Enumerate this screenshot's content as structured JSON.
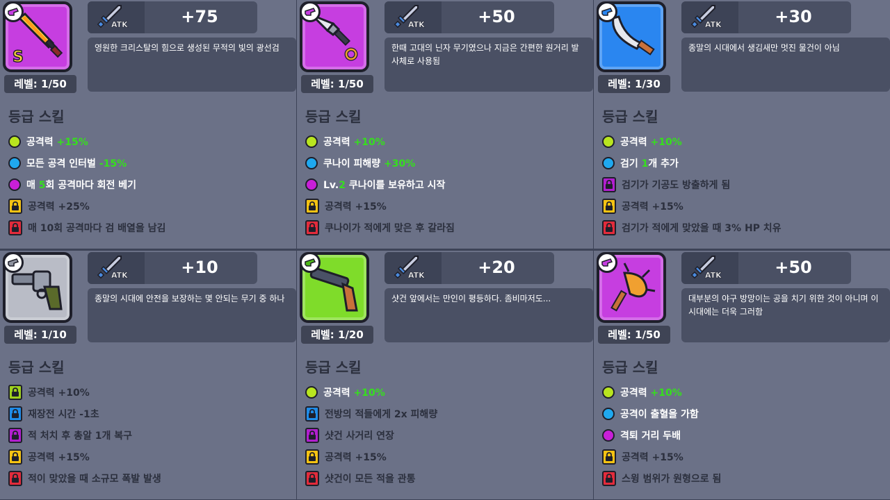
{
  "stat_icon_label": "ATK",
  "skill_header": "등급 스킬",
  "cards": [
    {
      "rarity": "purple",
      "hand_color": "#c63ee0",
      "item_icon": "light-sword-icon",
      "grade_mark": "S",
      "atk": "+75",
      "description": "영원한 크리스탈의 힘으로 생성된 무적의 빛의 광선검",
      "level": "레벨: 1/50",
      "skills": [
        {
          "kind": "dot",
          "color": "lime",
          "pre": "공격력 ",
          "hl": "+15%",
          "post": "",
          "locked": false
        },
        {
          "kind": "dot",
          "color": "cyan",
          "pre": "모든 공격 인터벌 ",
          "hl": "-15%",
          "post": "",
          "locked": false
        },
        {
          "kind": "dot",
          "color": "magenta",
          "pre": "매 ",
          "hl": "5",
          "post": "회 공격마다 회전 베기",
          "locked": false
        },
        {
          "kind": "lock",
          "color": "yellow",
          "pre": "공격력 +25%",
          "hl": "",
          "post": "",
          "locked": true
        },
        {
          "kind": "lock",
          "color": "red",
          "pre": "매 10회 공격마다 검 배열을 남김",
          "hl": "",
          "post": "",
          "locked": true
        }
      ]
    },
    {
      "rarity": "purple",
      "hand_color": "#c63ee0",
      "item_icon": "kunai-icon",
      "grade_mark": "",
      "atk": "+50",
      "description": "한때 고대의 닌자 무기였으나 지금은 간편한 원거리 발사체로 사용됨",
      "level": "레벨: 1/50",
      "skills": [
        {
          "kind": "dot",
          "color": "lime",
          "pre": "공격력 ",
          "hl": "+10%",
          "post": "",
          "locked": false
        },
        {
          "kind": "dot",
          "color": "cyan",
          "pre": "쿠나이 피해량 ",
          "hl": "+30%",
          "post": "",
          "locked": false
        },
        {
          "kind": "dot",
          "color": "magenta",
          "pre": "Lv.",
          "hl": "2",
          "post": " 쿠나이를 보유하고 시작",
          "locked": false
        },
        {
          "kind": "lock",
          "color": "yellow",
          "pre": "공격력 +15%",
          "hl": "",
          "post": "",
          "locked": true
        },
        {
          "kind": "lock",
          "color": "red",
          "pre": "쿠나이가 적에게 맞은 후 갈라짐",
          "hl": "",
          "post": "",
          "locked": true
        }
      ]
    },
    {
      "rarity": "blue",
      "hand_color": "#2a86f0",
      "item_icon": "machete-icon",
      "grade_mark": "",
      "atk": "+30",
      "description": "종말의 시대에서 생김새만 멋진 물건이 아님",
      "level": "레벨: 1/30",
      "skills": [
        {
          "kind": "dot",
          "color": "lime",
          "pre": "공격력 ",
          "hl": "+10%",
          "post": "",
          "locked": false
        },
        {
          "kind": "dot",
          "color": "cyan",
          "pre": "검기 ",
          "hl": "1",
          "post": "개 추가",
          "locked": false
        },
        {
          "kind": "lock",
          "color": "magenta",
          "pre": "검기가 기공도 방출하게 됨",
          "hl": "",
          "post": "",
          "locked": true
        },
        {
          "kind": "lock",
          "color": "yellow",
          "pre": "공격력 +15%",
          "hl": "",
          "post": "",
          "locked": true
        },
        {
          "kind": "lock",
          "color": "red",
          "pre": "검기가 적에게 맞았을 때 3% HP 치유",
          "hl": "",
          "post": "",
          "locked": true
        }
      ]
    },
    {
      "rarity": "gray",
      "hand_color": "#8f939f",
      "item_icon": "revolver-icon",
      "grade_mark": "",
      "atk": "+10",
      "description": "종말의 시대에 안전을 보장하는 몇 안되는 무기 중 하나",
      "level": "레벨: 1/10",
      "skills": [
        {
          "kind": "lock",
          "color": "lime",
          "pre": "공격력 +10%",
          "hl": "",
          "post": "",
          "locked": true
        },
        {
          "kind": "lock",
          "color": "cyan",
          "pre": "재장전 시간 -1초",
          "hl": "",
          "post": "",
          "locked": true
        },
        {
          "kind": "lock",
          "color": "magenta",
          "pre": "적 처치 후 총알 1개 복구",
          "hl": "",
          "post": "",
          "locked": true
        },
        {
          "kind": "lock",
          "color": "yellow",
          "pre": "공격력 +15%",
          "hl": "",
          "post": "",
          "locked": true
        },
        {
          "kind": "lock",
          "color": "red",
          "pre": "적이 맞았을 때 소규모 폭발 발생",
          "hl": "",
          "post": "",
          "locked": true
        }
      ]
    },
    {
      "rarity": "green",
      "hand_color": "#4fb81a",
      "item_icon": "shotgun-icon",
      "grade_mark": "",
      "atk": "+20",
      "description": "샷건 앞에서는 만인이 평등하다. 좀비마저도...",
      "level": "레벨: 1/20",
      "skills": [
        {
          "kind": "dot",
          "color": "lime",
          "pre": "공격력 ",
          "hl": "+10%",
          "post": "",
          "locked": false
        },
        {
          "kind": "lock",
          "color": "cyan",
          "pre": "전방의 적들에게 2x 피해량",
          "hl": "",
          "post": "",
          "locked": true
        },
        {
          "kind": "lock",
          "color": "magenta",
          "pre": "샷건 사거리 연장",
          "hl": "",
          "post": "",
          "locked": true
        },
        {
          "kind": "lock",
          "color": "yellow",
          "pre": "공격력 +15%",
          "hl": "",
          "post": "",
          "locked": true
        },
        {
          "kind": "lock",
          "color": "red",
          "pre": "샷건이 모든 적을 관통",
          "hl": "",
          "post": "",
          "locked": true
        }
      ]
    },
    {
      "rarity": "purple",
      "hand_color": "#c63ee0",
      "item_icon": "spiked-bat-icon",
      "grade_mark": "",
      "atk": "+50",
      "description": "대부분의 야구 방망이는 공을 치기 위한 것이 아니며 이 시대에는 더욱 그러함",
      "level": "레벨: 1/50",
      "skills": [
        {
          "kind": "dot",
          "color": "lime",
          "pre": "공격력 ",
          "hl": "+10%",
          "post": "",
          "locked": false
        },
        {
          "kind": "dot",
          "color": "cyan",
          "pre": "공격이 출혈을 가함",
          "hl": "",
          "post": "",
          "locked": false
        },
        {
          "kind": "dot",
          "color": "magenta",
          "pre": "격퇴 거리 두배",
          "hl": "",
          "post": "",
          "locked": false
        },
        {
          "kind": "lock",
          "color": "yellow",
          "pre": "공격력 +15%",
          "hl": "",
          "post": "",
          "locked": true
        },
        {
          "kind": "lock",
          "color": "red",
          "pre": "스윙 범위가 원형으로 됨",
          "hl": "",
          "post": "",
          "locked": true
        }
      ]
    }
  ]
}
